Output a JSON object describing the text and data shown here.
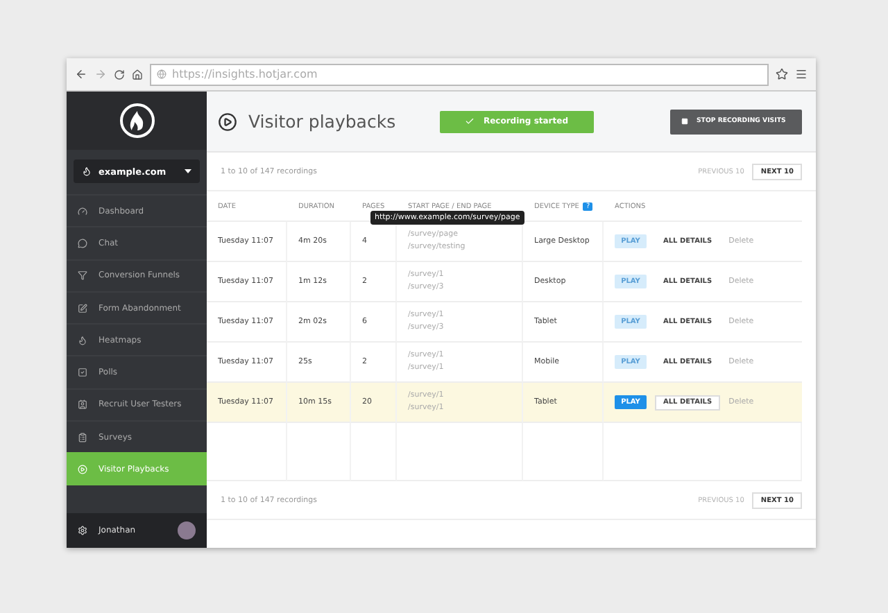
{
  "browser": {
    "url": "https://insights.hotjar.com"
  },
  "sidebar": {
    "site": "example.com",
    "items": [
      {
        "label": "Dashboard",
        "selected": false
      },
      {
        "label": "Chat",
        "selected": false
      },
      {
        "label": "Conversion Funnels",
        "selected": false
      },
      {
        "label": "Form Abandonment",
        "selected": false
      },
      {
        "label": "Heatmaps",
        "selected": false
      },
      {
        "label": "Polls",
        "selected": false
      },
      {
        "label": "Recruit User Testers",
        "selected": false
      },
      {
        "label": "Surveys",
        "selected": false
      },
      {
        "label": "Visitor Playbacks",
        "selected": true
      }
    ],
    "user": "Jonathan"
  },
  "header": {
    "title": "Visitor playbacks",
    "status": "Recording started",
    "stop_button": "STOP RECORDING VISITS"
  },
  "pagination_top": {
    "summary": "1 to 10 of 147 recordings",
    "previous": "PREVIOUS 10",
    "previous_disabled": true,
    "next": "NEXT 10"
  },
  "table": {
    "columns": [
      "DATE",
      "DURATION",
      "PAGES",
      "START PAGE / END PAGE",
      "DEVICE TYPE",
      "ACTIONS"
    ],
    "device_help": "?",
    "tooltip": "http://www.example.com/survey/page",
    "rows": [
      {
        "date": "Tuesday 11:07",
        "duration": "4m 20s",
        "pages": "4",
        "start_page": "/survey/page",
        "end_page": "/survey/testing",
        "device": "Large Desktop",
        "play": "PLAY",
        "details": "ALL DETAILS",
        "delete": "Delete",
        "selected": false
      },
      {
        "date": "Tuesday 11:07",
        "duration": "1m 12s",
        "pages": "2",
        "start_page": "/survey/1",
        "end_page": "/survey/3",
        "device": "Desktop",
        "play": "PLAY",
        "details": "ALL DETAILS",
        "delete": "Delete",
        "selected": false
      },
      {
        "date": "Tuesday 11:07",
        "duration": "2m 02s",
        "pages": "6",
        "start_page": "/survey/1",
        "end_page": "/survey/3",
        "device": "Tablet",
        "play": "PLAY",
        "details": "ALL DETAILS",
        "delete": "Delete",
        "selected": false
      },
      {
        "date": "Tuesday 11:07",
        "duration": "25s",
        "pages": "2",
        "start_page": "/survey/1",
        "end_page": "/survey/1",
        "device": "Mobile",
        "play": "PLAY",
        "details": "ALL DETAILS",
        "delete": "Delete",
        "selected": false
      },
      {
        "date": "Tuesday 11:07",
        "duration": "10m 15s",
        "pages": "20",
        "start_page": "/survey/1",
        "end_page": "/survey/1",
        "device": "Tablet",
        "play": "PLAY",
        "details": "ALL DETAILS",
        "delete": "Delete",
        "selected": true
      }
    ]
  },
  "pagination_bottom": {
    "summary": "1 to 10 of 147 recordings",
    "previous": "PREVIOUS 10",
    "previous_disabled": true,
    "next": "NEXT 10"
  }
}
